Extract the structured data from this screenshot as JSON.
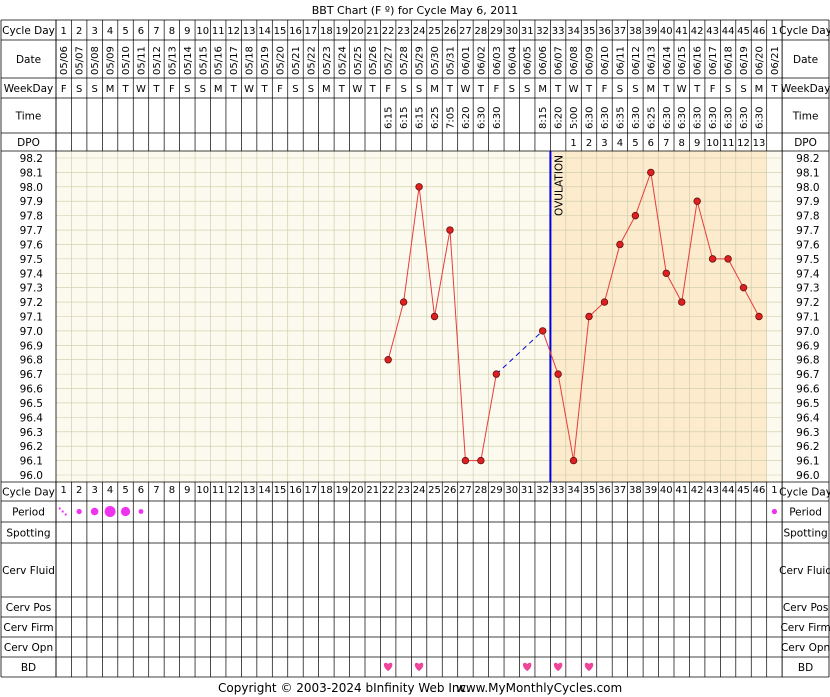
{
  "header": {
    "title": "BBT Chart (F º) for Cycle May 6, 2011"
  },
  "footer": {
    "copyright": "Copyright © 2003-2024 bInfinity Web Inc.",
    "site": "www.MyMonthlyCycles.com"
  },
  "labels": {
    "cycle_day": "Cycle Day",
    "date": "Date",
    "weekday": "WeekDay",
    "time": "Time",
    "dpo": "DPO",
    "period": "Period",
    "spotting": "Spotting",
    "cerv_fluid": "Cerv Fluid",
    "cerv_pos": "Cerv Pos",
    "cerv_firm": "Cerv Firm",
    "cerv_opn": "Cerv Opn",
    "bd": "BD",
    "ovulation": "OVULATION"
  },
  "colors": {
    "pre_ovulation_bg": "#fcfaee",
    "post_ovulation_bg": "#fcebcc",
    "temp_line": "#e83c3c",
    "temp_point": "#e02020",
    "ovulation_line": "#0000dd",
    "period_marker": "#ee33ee",
    "bd_heart": "#ee4499",
    "grid_dark": "#000000",
    "grid_light": "#c9c9a4"
  },
  "chart_data": {
    "type": "line",
    "title": "BBT Chart (F º) for Cycle May 6, 2011",
    "cycle_days": [
      1,
      2,
      3,
      4,
      5,
      6,
      7,
      8,
      9,
      10,
      11,
      12,
      13,
      14,
      15,
      16,
      17,
      18,
      19,
      20,
      21,
      22,
      23,
      24,
      25,
      26,
      27,
      28,
      29,
      30,
      31,
      32,
      33,
      34,
      35,
      36,
      37,
      38,
      39,
      40,
      41,
      42,
      43,
      44,
      45,
      46,
      1
    ],
    "dates": [
      "05/06",
      "05/07",
      "05/08",
      "05/09",
      "05/10",
      "05/11",
      "05/12",
      "05/13",
      "05/14",
      "05/15",
      "05/16",
      "05/17",
      "05/18",
      "05/19",
      "05/20",
      "05/21",
      "05/22",
      "05/23",
      "05/24",
      "05/25",
      "05/26",
      "05/27",
      "05/28",
      "05/29",
      "05/30",
      "05/31",
      "06/01",
      "06/02",
      "06/03",
      "06/04",
      "06/05",
      "06/06",
      "06/07",
      "06/08",
      "06/09",
      "06/10",
      "06/11",
      "06/12",
      "06/13",
      "06/14",
      "06/15",
      "06/16",
      "06/17",
      "06/18",
      "06/19",
      "06/20",
      "06/21"
    ],
    "weekdays": [
      "F",
      "S",
      "S",
      "M",
      "T",
      "W",
      "T",
      "F",
      "S",
      "S",
      "M",
      "T",
      "W",
      "T",
      "F",
      "S",
      "S",
      "M",
      "T",
      "W",
      "T",
      "F",
      "S",
      "S",
      "M",
      "T",
      "W",
      "T",
      "F",
      "S",
      "S",
      "M",
      "T",
      "W",
      "T",
      "F",
      "S",
      "S",
      "M",
      "T",
      "W",
      "T",
      "F",
      "S",
      "S",
      "M",
      "T"
    ],
    "times": [
      "",
      "",
      "",
      "",
      "",
      "",
      "",
      "",
      "",
      "",
      "",
      "",
      "",
      "",
      "",
      "",
      "",
      "",
      "",
      "",
      "",
      "6:15",
      "6:15",
      "6:15",
      "6:25",
      "7:05",
      "6:20",
      "6:30",
      "6:30",
      "",
      "",
      "8:15",
      "6:20",
      "5:00",
      "6:30",
      "6:30",
      "6:35",
      "6:30",
      "6:25",
      "6:30",
      "6:30",
      "6:30",
      "6:30",
      "6:30",
      "6:30",
      "6:30",
      ""
    ],
    "dpo": [
      "",
      "",
      "",
      "",
      "",
      "",
      "",
      "",
      "",
      "",
      "",
      "",
      "",
      "",
      "",
      "",
      "",
      "",
      "",
      "",
      "",
      "",
      "",
      "",
      "",
      "",
      "",
      "",
      "",
      "",
      "",
      "",
      "",
      "1",
      "2",
      "3",
      "4",
      "5",
      "6",
      "7",
      "8",
      "9",
      "10",
      "11",
      "12",
      "13",
      ""
    ],
    "temperatures": [
      null,
      null,
      null,
      null,
      null,
      null,
      null,
      null,
      null,
      null,
      null,
      null,
      null,
      null,
      null,
      null,
      null,
      null,
      null,
      null,
      null,
      96.8,
      97.2,
      98.0,
      97.1,
      97.7,
      96.1,
      96.1,
      96.7,
      null,
      null,
      97.0,
      96.7,
      96.1,
      97.1,
      97.2,
      97.6,
      97.8,
      98.1,
      97.4,
      97.2,
      97.9,
      97.5,
      97.5,
      97.3,
      97.1,
      null
    ],
    "y_ticks": [
      98.2,
      98.1,
      98.0,
      97.9,
      97.8,
      97.7,
      97.6,
      97.5,
      97.4,
      97.3,
      97.2,
      97.1,
      97.0,
      96.9,
      96.8,
      96.7,
      96.6,
      96.5,
      96.4,
      96.3,
      96.2,
      96.1,
      96.0
    ],
    "ylim": [
      96.0,
      98.2
    ],
    "ovulation_after_index": 32,
    "dashed_gaps": [
      [
        28,
        31
      ]
    ],
    "period": [
      1,
      2,
      3,
      4,
      5,
      6,
      0,
      0,
      0,
      0,
      0,
      0,
      0,
      0,
      0,
      0,
      0,
      0,
      0,
      0,
      0,
      0,
      0,
      0,
      0,
      0,
      0,
      0,
      0,
      0,
      0,
      0,
      0,
      0,
      0,
      0,
      0,
      0,
      0,
      0,
      0,
      0,
      0,
      0,
      0,
      0,
      2
    ],
    "bd_days": [
      21,
      23,
      30,
      32,
      34
    ],
    "grid": true,
    "legend": "none"
  }
}
